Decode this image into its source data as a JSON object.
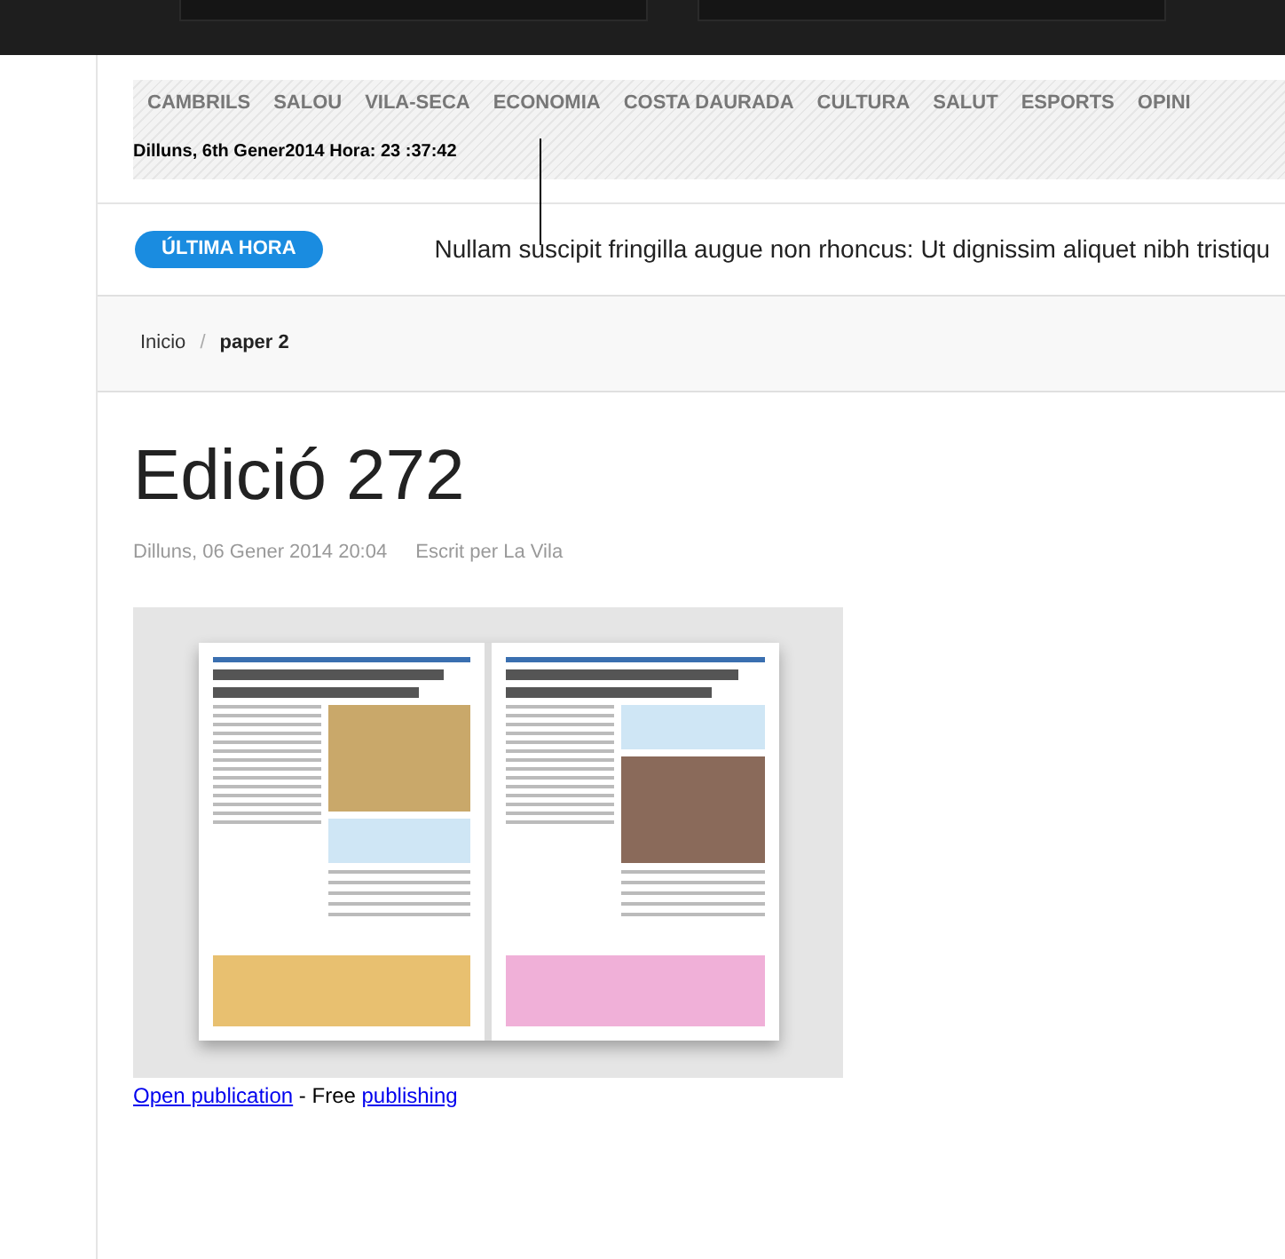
{
  "nav": {
    "items": [
      {
        "label": "CAMBRILS"
      },
      {
        "label": "SALOU"
      },
      {
        "label": "VILA-SECA"
      },
      {
        "label": "ECONOMIA"
      },
      {
        "label": "COSTA DAURADA"
      },
      {
        "label": "CULTURA"
      },
      {
        "label": "SALUT"
      },
      {
        "label": "ESPORTS"
      },
      {
        "label": "OPINI"
      }
    ],
    "datetime": "Dilluns, 6th Gener2014 Hora: 23 :37:42"
  },
  "ticker": {
    "badge": "ÚLTIMA HORA",
    "text": "Nullam suscipit fringilla augue non rhoncus: Ut dignissim aliquet nibh tristiqu"
  },
  "breadcrumb_separator": "/",
  "breadcrumb": [
    {
      "label": "Inicio",
      "current": false
    },
    {
      "label": "paper 2",
      "current": true
    }
  ],
  "article": {
    "title": "Edició 272",
    "date": "Dilluns, 06 Gener 2014 20:04",
    "author": "Escrit per La Vila"
  },
  "embed": {
    "links": [
      {
        "kind": "link",
        "text": "Open publication"
      },
      {
        "kind": "text",
        "text": " - Free "
      },
      {
        "kind": "link",
        "text": "publishing"
      }
    ]
  }
}
